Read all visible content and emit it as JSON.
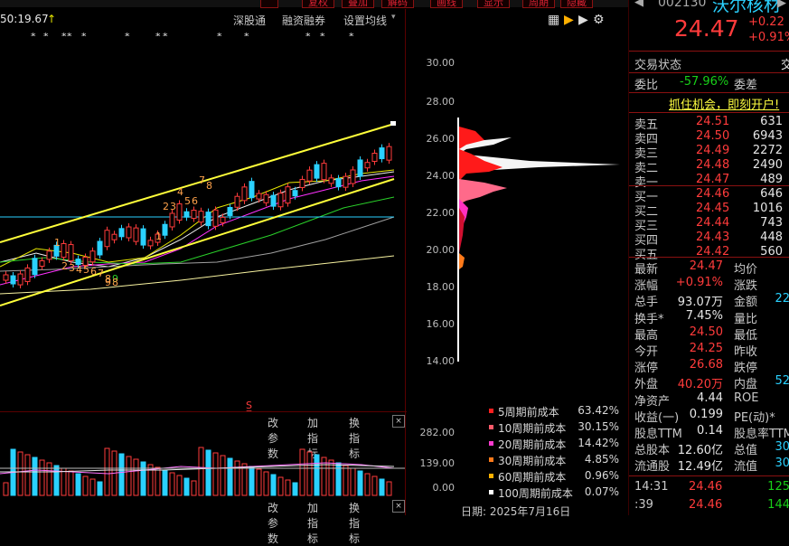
{
  "toolbar": {
    "buttons": [
      "复权",
      "叠加",
      "解码",
      "画线",
      "显示",
      "周期",
      "隐藏"
    ]
  },
  "header": {
    "price_readout": "50:19.67",
    "menu": [
      "深股通",
      "融资融券",
      "设置均线"
    ]
  },
  "chart_menu": {
    "items": [
      "改参数",
      "加指标",
      "换指标"
    ]
  },
  "vol_menu": {
    "items": [
      "改参数",
      "加指标",
      "换指标"
    ]
  },
  "price_axis": [
    "30.00",
    "28.00",
    "26.00",
    "24.00",
    "22.00",
    "20.00",
    "18.00",
    "16.00",
    "14.00"
  ],
  "volume_axis": [
    "282.00",
    "139.00",
    "0.00"
  ],
  "chart_numbers": [
    "1",
    "2",
    "3",
    "4",
    "5",
    "6",
    "7",
    "8",
    "9",
    "1",
    "2",
    "3",
    "4",
    "5",
    "6",
    "7",
    "8",
    "9",
    "8",
    "9"
  ],
  "cost_legend": [
    {
      "label": "5周期前成本",
      "value": "63.42%",
      "color": "#ff2020"
    },
    {
      "label": "10周期前成本",
      "value": "30.15%",
      "color": "#ff5a6a"
    },
    {
      "label": "20周期前成本",
      "value": "14.42%",
      "color": "#ff3bd0"
    },
    {
      "label": "30周期前成本",
      "value": "4.85%",
      "color": "#ff7a1a"
    },
    {
      "label": "60周期前成本",
      "value": "0.96%",
      "color": "#ffb000"
    },
    {
      "label": "100周期前成本",
      "value": "0.07%",
      "color": "#ffffff"
    }
  ],
  "date_label": "日期: 2025年7月16日",
  "quote": {
    "code": "002130",
    "name": "沃尔核材",
    "price": "24.47",
    "change": "+0.22",
    "change_pct": "+0.91%"
  },
  "panel": {
    "trade_status": "交易状态",
    "trade_status_val": "交",
    "webi_label": "委比",
    "webi_val": "-57.96%",
    "weicha_label": "委差",
    "promo": "抓住机会，即刻开户!",
    "sell": [
      {
        "label": "卖五",
        "price": "24.51",
        "vol": "631"
      },
      {
        "label": "卖四",
        "price": "24.50",
        "vol": "6943"
      },
      {
        "label": "卖三",
        "price": "24.49",
        "vol": "2272"
      },
      {
        "label": "卖二",
        "price": "24.48",
        "vol": "2490"
      },
      {
        "label": "卖一",
        "price": "24.47",
        "vol": "489"
      }
    ],
    "buy": [
      {
        "label": "买一",
        "price": "24.46",
        "vol": "646"
      },
      {
        "label": "买二",
        "price": "24.45",
        "vol": "1016"
      },
      {
        "label": "买三",
        "price": "24.44",
        "vol": "743"
      },
      {
        "label": "买四",
        "price": "24.43",
        "vol": "448"
      },
      {
        "label": "买五",
        "price": "24.42",
        "vol": "560"
      }
    ],
    "stats": [
      {
        "l1": "最新",
        "v1": "24.47",
        "l2": "均价",
        "v2": ""
      },
      {
        "l1": "涨幅",
        "v1": "+0.91%",
        "l2": "涨跌",
        "v2": ""
      },
      {
        "l1": "总手",
        "v1": "93.07万",
        "l2": "金额",
        "v2": "22"
      },
      {
        "l1": "换手*",
        "v1": "7.45%",
        "l2": "量比",
        "v2": ""
      },
      {
        "l1": "最高",
        "v1": "24.50",
        "l2": "最低",
        "v2": ""
      },
      {
        "l1": "今开",
        "v1": "24.25",
        "l2": "昨收",
        "v2": ""
      },
      {
        "l1": "涨停",
        "v1": "26.68",
        "l2": "跌停",
        "v2": ""
      },
      {
        "l1": "外盘",
        "v1": "40.20万",
        "l2": "内盘",
        "v2": "52"
      },
      {
        "l1": "净资产",
        "v1": "4.44",
        "l2": "ROE",
        "v2": ""
      },
      {
        "l1": "收益(一)",
        "v1": "0.199",
        "l2": "PE(动)*",
        "v2": ""
      },
      {
        "l1": "股息TTM",
        "v1": "0.14",
        "l2": "股息率TTM",
        "v2": ""
      },
      {
        "l1": "总股本",
        "v1": "12.60亿",
        "l2": "总值",
        "v2": "30"
      },
      {
        "l1": "流通股",
        "v1": "12.49亿",
        "l2": "流值",
        "v2": "30"
      }
    ],
    "ticks": [
      {
        "time": "14:31",
        "price": "24.46",
        "vol": "125"
      },
      {
        "time": ":39",
        "price": "24.46",
        "vol": "144"
      }
    ]
  }
}
